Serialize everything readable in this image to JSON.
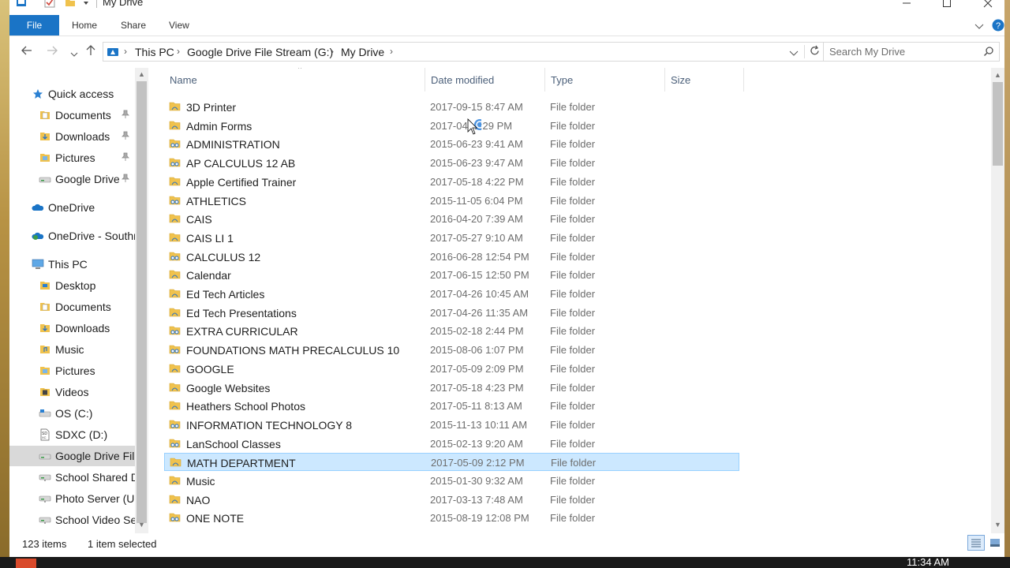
{
  "window": {
    "title": "My Drive"
  },
  "ribbon": {
    "file": "File",
    "tabs": [
      "Home",
      "Share",
      "View"
    ]
  },
  "address": {
    "crumbs": [
      "This PC",
      "Google Drive File Stream (G:)",
      "My Drive"
    ]
  },
  "search": {
    "placeholder": "Search My Drive"
  },
  "columns": {
    "name": "Name",
    "date": "Date modified",
    "type": "Type",
    "size": "Size"
  },
  "navpane": {
    "items": [
      {
        "label": "Quick access",
        "icon": "star-icon",
        "level": 0,
        "pinned": false
      },
      {
        "label": "Documents",
        "icon": "documents-icon",
        "level": 1,
        "pinned": true
      },
      {
        "label": "Downloads",
        "icon": "downloads-icon",
        "level": 1,
        "pinned": true
      },
      {
        "label": "Pictures",
        "icon": "pictures-icon",
        "level": 1,
        "pinned": true
      },
      {
        "label": "Google Drive",
        "icon": "drive-icon",
        "level": 1,
        "pinned": true
      },
      {
        "label": "OneDrive",
        "icon": "onedrive-icon",
        "level": 0,
        "pinned": false
      },
      {
        "label": "OneDrive - Southr",
        "icon": "onedrive-business-icon",
        "level": 0,
        "pinned": false
      },
      {
        "label": "This PC",
        "icon": "pc-icon",
        "level": 0,
        "pinned": false
      },
      {
        "label": "Desktop",
        "icon": "desktop-icon",
        "level": 1,
        "pinned": false
      },
      {
        "label": "Documents",
        "icon": "documents-icon",
        "level": 1,
        "pinned": false
      },
      {
        "label": "Downloads",
        "icon": "downloads-icon",
        "level": 1,
        "pinned": false
      },
      {
        "label": "Music",
        "icon": "music-icon",
        "level": 1,
        "pinned": false
      },
      {
        "label": "Pictures",
        "icon": "pictures-icon",
        "level": 1,
        "pinned": false
      },
      {
        "label": "Videos",
        "icon": "videos-icon",
        "level": 1,
        "pinned": false
      },
      {
        "label": "OS (C:)",
        "icon": "disk-icon",
        "level": 1,
        "pinned": false
      },
      {
        "label": "SDXC (D:)",
        "icon": "sd-card-icon",
        "level": 1,
        "pinned": false
      },
      {
        "label": "Google Drive File",
        "icon": "drive-icon",
        "level": 1,
        "pinned": false,
        "selected": true
      },
      {
        "label": "School Shared D",
        "icon": "network-drive-icon",
        "level": 1,
        "pinned": false
      },
      {
        "label": "Photo Server (U:)",
        "icon": "network-drive-icon",
        "level": 1,
        "pinned": false
      },
      {
        "label": "School Video Ser",
        "icon": "network-drive-icon",
        "level": 1,
        "pinned": false
      }
    ]
  },
  "files": [
    {
      "name": "3D Printer",
      "date": "2017-09-15 8:47 AM",
      "type": "File folder",
      "shared": false
    },
    {
      "name": "Admin Forms",
      "date": "2017-04-  1:29 PM",
      "type": "File folder",
      "shared": false
    },
    {
      "name": "ADMINISTRATION",
      "date": "2015-06-23 9:41 AM",
      "type": "File folder",
      "shared": true
    },
    {
      "name": "AP CALCULUS 12 AB",
      "date": "2015-06-23 9:47 AM",
      "type": "File folder",
      "shared": true
    },
    {
      "name": "Apple Certified Trainer",
      "date": "2017-05-18 4:22 PM",
      "type": "File folder",
      "shared": false
    },
    {
      "name": "ATHLETICS",
      "date": "2015-11-05 6:04 PM",
      "type": "File folder",
      "shared": true
    },
    {
      "name": "CAIS",
      "date": "2016-04-20 7:39 AM",
      "type": "File folder",
      "shared": false
    },
    {
      "name": "CAIS LI 1",
      "date": "2017-05-27 9:10 AM",
      "type": "File folder",
      "shared": false
    },
    {
      "name": "CALCULUS 12",
      "date": "2016-06-28 12:54 PM",
      "type": "File folder",
      "shared": true
    },
    {
      "name": "Calendar",
      "date": "2017-06-15 12:50 PM",
      "type": "File folder",
      "shared": false
    },
    {
      "name": "Ed Tech Articles",
      "date": "2017-04-26 10:45 AM",
      "type": "File folder",
      "shared": false
    },
    {
      "name": "Ed Tech Presentations",
      "date": "2017-04-26 11:35 AM",
      "type": "File folder",
      "shared": false
    },
    {
      "name": "EXTRA CURRICULAR",
      "date": "2015-02-18 2:44 PM",
      "type": "File folder",
      "shared": true
    },
    {
      "name": "FOUNDATIONS MATH PRECALCULUS 10",
      "date": "2015-08-06 1:07 PM",
      "type": "File folder",
      "shared": true
    },
    {
      "name": "GOOGLE",
      "date": "2017-05-09 2:09 PM",
      "type": "File folder",
      "shared": false
    },
    {
      "name": "Google Websites",
      "date": "2017-05-18 4:23 PM",
      "type": "File folder",
      "shared": false
    },
    {
      "name": "Heathers School Photos",
      "date": "2017-05-11 8:13 AM",
      "type": "File folder",
      "shared": false
    },
    {
      "name": "INFORMATION TECHNOLOGY 8",
      "date": "2015-11-13 10:11 AM",
      "type": "File folder",
      "shared": true
    },
    {
      "name": "LanSchool Classes",
      "date": "2015-02-13 9:20 AM",
      "type": "File folder",
      "shared": true
    },
    {
      "name": "MATH DEPARTMENT",
      "date": "2017-05-09 2:12 PM",
      "type": "File folder",
      "shared": false,
      "selected": true
    },
    {
      "name": "Music",
      "date": "2015-01-30 9:32 AM",
      "type": "File folder",
      "shared": false
    },
    {
      "name": "NAO",
      "date": "2017-03-13 7:48 AM",
      "type": "File folder",
      "shared": false
    },
    {
      "name": "ONE NOTE",
      "date": "2015-08-19 12:08 PM",
      "type": "File folder",
      "shared": true
    }
  ],
  "status": {
    "count": "123 items",
    "selected": "1 item selected"
  },
  "taskbar": {
    "clock": "11:34 AM"
  },
  "colors": {
    "accent": "#1a74c6",
    "selection": "#cce8ff",
    "selection_border": "#99d1ff",
    "folder": "#f0c24d"
  }
}
